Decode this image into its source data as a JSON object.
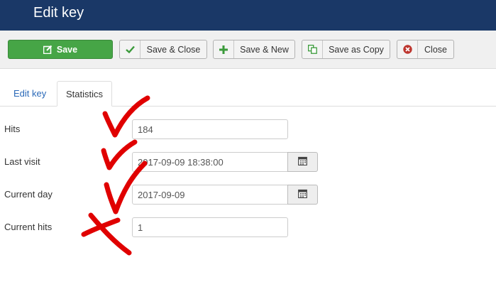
{
  "header": {
    "title": "Edit key"
  },
  "toolbar": {
    "save_label": "Save",
    "save_close_label": "Save & Close",
    "save_new_label": "Save & New",
    "save_copy_label": "Save as Copy",
    "close_label": "Close"
  },
  "tabs": [
    {
      "label": "Edit key",
      "active": false
    },
    {
      "label": "Statistics",
      "active": true
    }
  ],
  "form": {
    "hits": {
      "label": "Hits",
      "value": "184"
    },
    "last_visit": {
      "label": "Last visit",
      "value": "2017-09-09 18:38:00"
    },
    "current_day": {
      "label": "Current day",
      "value": "2017-09-09"
    },
    "current_hits": {
      "label": "Current hits",
      "value": "1"
    }
  },
  "colors": {
    "header_bg": "#1a3867",
    "save_green": "#46a546",
    "link_blue": "#2a69b8",
    "annotation_red": "#e00000"
  },
  "icons": [
    "edit-icon",
    "check-icon",
    "plus-icon",
    "copy-icon",
    "close-circle-icon",
    "calendar-icon",
    "handwritten-checkmark",
    "handwritten-cross"
  ]
}
